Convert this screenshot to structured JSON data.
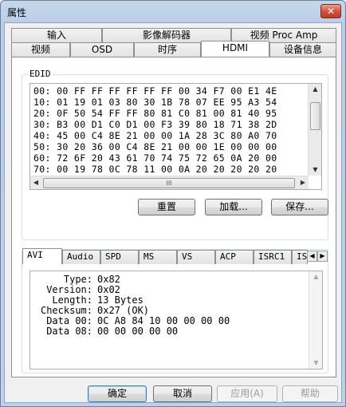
{
  "window": {
    "title": "属性",
    "close_glyph": "✕"
  },
  "tabs_row1": [
    "输入",
    "影像解码器",
    "视频 Proc Amp"
  ],
  "tabs_row2": [
    "视频",
    "OSD",
    "时序",
    "HDMI",
    "设备信息"
  ],
  "selected_tab": "HDMI",
  "edid": {
    "label": "EDID",
    "lines": [
      "00: 00 FF FF FF FF FF FF 00 34 F7 00 E1 4E",
      "10: 01 19 01 03 80 30 1B 78 07 EE 95 A3 54",
      "20: 0F 50 54 FF FF 80 81 C0 81 00 81 40 95",
      "30: B3 00 D1 C0 D1 00 F3 39 80 18 71 38 2D",
      "40: 45 00 C4 8E 21 00 00 1A 28 3C 80 A0 70",
      "50: 30 20 36 00 C4 8E 21 00 00 1E 00 00 00",
      "60: 72 6F 20 43 61 70 74 75 72 65 0A 20 00",
      "70: 00 19 78 0C 78 11 00 0A 20 20 20 20 20"
    ],
    "hscroll_glyph": "III",
    "buttons": {
      "reset": "重置",
      "load": "加载...",
      "save": "保存..."
    }
  },
  "info_tabs": [
    "AVI",
    "Audio",
    "SPD",
    "MS",
    "VS",
    "ACP",
    "ISRC1",
    "IS"
  ],
  "selected_info_tab": "AVI",
  "avi": [
    {
      "key": "Type:",
      "value": "0x82"
    },
    {
      "key": "Version:",
      "value": "0x02"
    },
    {
      "key": "Length:",
      "value": "13 Bytes"
    },
    {
      "key": "Checksum:",
      "value": "0x27 (OK)"
    },
    {
      "key": "Data 00:",
      "value": "0C A8 84 10 00 00 00 00"
    },
    {
      "key": "Data 08:",
      "value": "00 00 00 00 00"
    }
  ],
  "footer": {
    "ok": "确定",
    "cancel": "取消",
    "apply": "应用(A)",
    "help": "帮助"
  }
}
